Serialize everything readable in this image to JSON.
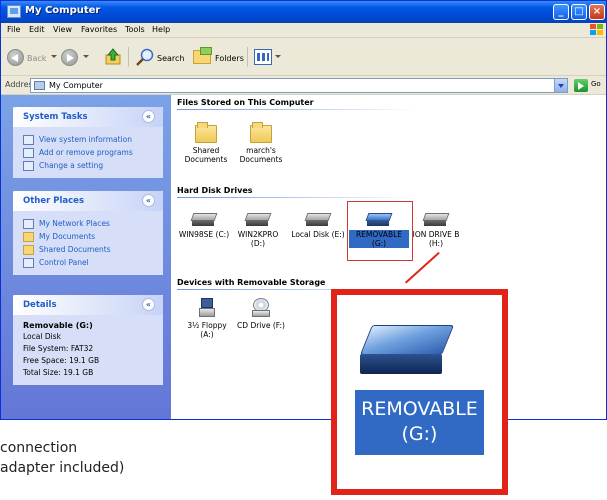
{
  "window": {
    "title": "My Computer"
  },
  "menu": {
    "file": "File",
    "edit": "Edit",
    "view": "View",
    "favorites": "Favorites",
    "tools": "Tools",
    "help": "Help"
  },
  "toolbar": {
    "back": "Back",
    "search": "Search",
    "folders": "Folders"
  },
  "address": {
    "label": "Address",
    "value": "My Computer",
    "go": "Go"
  },
  "panels": {
    "system_tasks": {
      "title": "System Tasks",
      "items": [
        "View system information",
        "Add or remove programs",
        "Change a setting"
      ]
    },
    "other_places": {
      "title": "Other Places",
      "items": [
        "My Network Places",
        "My Documents",
        "Shared Documents",
        "Control Panel"
      ]
    },
    "details": {
      "title": "Details",
      "name": "Removable (G:)",
      "type": "Local Disk",
      "file_system": "File System: FAT32",
      "free_space": "Free Space: 19.1 GB",
      "total_size": "Total Size: 19.1 GB"
    }
  },
  "groups": {
    "stored": {
      "title": "Files Stored on This Computer",
      "items": [
        {
          "line1": "Shared",
          "line2": "Documents"
        },
        {
          "line1": "march's",
          "line2": "Documents"
        }
      ]
    },
    "hdd": {
      "title": "Hard Disk Drives",
      "items": [
        {
          "line1": "WIN98SE (C:)",
          "line2": ""
        },
        {
          "line1": "WIN2KPRO",
          "line2": "(D:)"
        },
        {
          "line1": "Local Disk (E:)",
          "line2": ""
        },
        {
          "line1": "REMOVABLE",
          "line2": "(G:)"
        },
        {
          "line1": "ION DRIVE B",
          "line2": "(H:)"
        }
      ]
    },
    "removable": {
      "title": "Devices with Removable Storage",
      "items": [
        {
          "line1": "3½ Floppy",
          "line2": "(A:)"
        },
        {
          "line1": "CD Drive (F:)",
          "line2": ""
        }
      ]
    }
  },
  "zoom": {
    "line1": "REMOVABLE",
    "line2": "(G:)"
  },
  "captions": {
    "line1": "connection",
    "line2": "adapter included)"
  },
  "colors": {
    "titlebar": "#0058e6",
    "taskpane": "#6375d6",
    "panel_link": "#215dc6",
    "selection": "#316ac5",
    "callout": "#e2231a"
  },
  "icons": [
    "my-computer-icon",
    "folder-icon",
    "hard-drive-icon",
    "removable-drive-icon",
    "floppy-drive-icon",
    "cd-drive-icon"
  ]
}
